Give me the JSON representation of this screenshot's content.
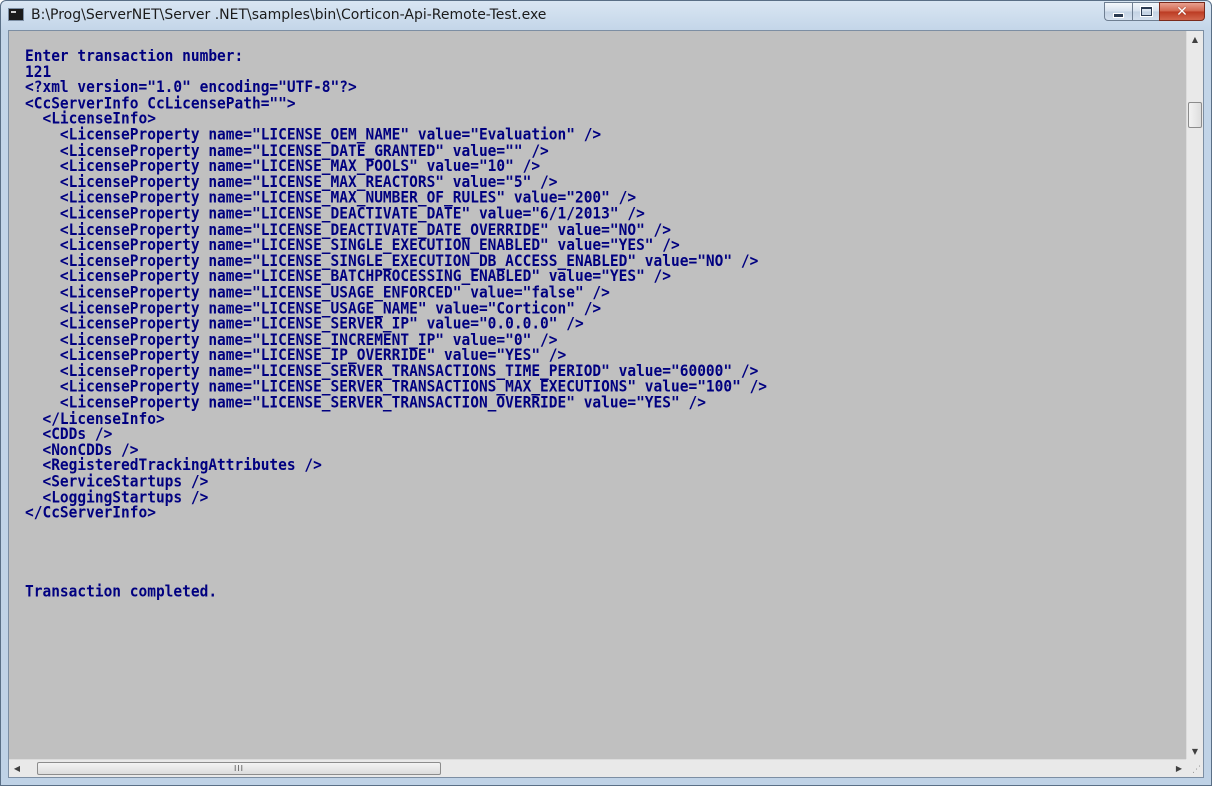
{
  "window": {
    "title": "B:\\Prog\\ServerNET\\Server .NET\\samples\\bin\\Corticon-Api-Remote-Test.exe",
    "app_icon": "console-window-icon",
    "buttons": {
      "minimize_icon": "minimize-icon",
      "maximize_icon": "maximize-icon",
      "close_icon": "close-icon",
      "close_glyph": "✕"
    }
  },
  "console": {
    "text_color": "#000080",
    "background": "#c0c0c0",
    "lines": [
      "Enter transaction number:",
      "121",
      "<?xml version=\"1.0\" encoding=\"UTF-8\"?>",
      "<CcServerInfo CcLicensePath=\"\">",
      "  <LicenseInfo>",
      "    <LicenseProperty name=\"LICENSE_OEM_NAME\" value=\"Evaluation\" />",
      "    <LicenseProperty name=\"LICENSE_DATE_GRANTED\" value=\"\" />",
      "    <LicenseProperty name=\"LICENSE_MAX_POOLS\" value=\"10\" />",
      "    <LicenseProperty name=\"LICENSE_MAX_REACTORS\" value=\"5\" />",
      "    <LicenseProperty name=\"LICENSE_MAX_NUMBER_OF_RULES\" value=\"200\" />",
      "    <LicenseProperty name=\"LICENSE_DEACTIVATE_DATE\" value=\"6/1/2013\" />",
      "    <LicenseProperty name=\"LICENSE_DEACTIVATE_DATE_OVERRIDE\" value=\"NO\" />",
      "    <LicenseProperty name=\"LICENSE_SINGLE_EXECUTION_ENABLED\" value=\"YES\" />",
      "    <LicenseProperty name=\"LICENSE_SINGLE_EXECUTION_DB_ACCESS_ENABLED\" value=\"NO\" />",
      "    <LicenseProperty name=\"LICENSE_BATCHPROCESSING_ENABLED\" value=\"YES\" />",
      "    <LicenseProperty name=\"LICENSE_USAGE_ENFORCED\" value=\"false\" />",
      "    <LicenseProperty name=\"LICENSE_USAGE_NAME\" value=\"Corticon\" />",
      "    <LicenseProperty name=\"LICENSE_SERVER_IP\" value=\"0.0.0.0\" />",
      "    <LicenseProperty name=\"LICENSE_INCREMENT_IP\" value=\"0\" />",
      "    <LicenseProperty name=\"LICENSE_IP_OVERRIDE\" value=\"YES\" />",
      "    <LicenseProperty name=\"LICENSE_SERVER_TRANSACTIONS_TIME_PERIOD\" value=\"60000\" />",
      "    <LicenseProperty name=\"LICENSE_SERVER_TRANSACTIONS_MAX_EXECUTIONS\" value=\"100\" />",
      "    <LicenseProperty name=\"LICENSE_SERVER_TRANSACTION_OVERRIDE\" value=\"YES\" />",
      "  </LicenseInfo>",
      "  <CDDs />",
      "  <NonCDDs />",
      "  <RegisteredTrackingAttributes />",
      "  <ServiceStartups />",
      "  <LoggingStartups />",
      "</CcServerInfo>",
      "",
      "",
      "",
      "",
      "Transaction completed."
    ]
  },
  "scrollbars": {
    "up_arrow": "▲",
    "down_arrow": "▼",
    "left_arrow": "◀",
    "right_arrow": "▶",
    "hthumb_grip": "III",
    "resize_grip": "⋰"
  }
}
